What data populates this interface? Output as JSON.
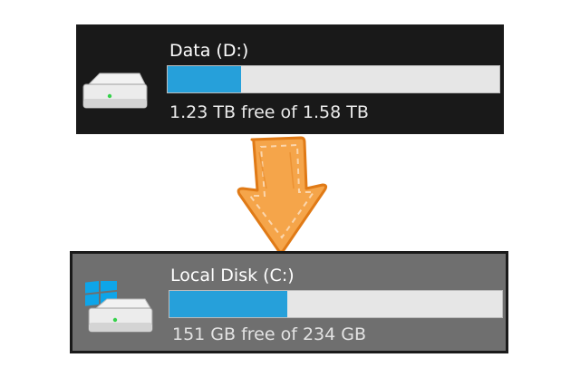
{
  "drives": [
    {
      "name": "Data (D:)",
      "caption": "1.23 TB free of 1.58 TB",
      "used_fraction": 0.22,
      "has_windows_logo": false
    },
    {
      "name": "Local Disk (C:)",
      "caption": "151 GB free of 234 GB",
      "used_fraction": 0.355,
      "has_windows_logo": true
    }
  ],
  "arrow": {
    "direction": "down",
    "icon": "arrow-down-icon",
    "fill_color": "#f5a54a",
    "outline_color": "#e07a16"
  },
  "colors": {
    "usage_fill": "#26a0da",
    "usage_track": "#e6e6e6",
    "windows_logo": "#0ea5e9"
  }
}
